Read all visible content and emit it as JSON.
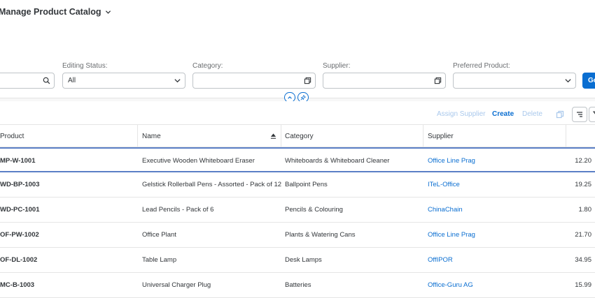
{
  "header": {
    "title": "Manage Product Catalog"
  },
  "filters": [
    {
      "key": "search",
      "label": "",
      "value": ""
    },
    {
      "key": "editing_status",
      "label": "Editing Status:",
      "value": "All"
    },
    {
      "key": "category",
      "label": "Category:",
      "value": ""
    },
    {
      "key": "supplier",
      "label": "Supplier:",
      "value": ""
    },
    {
      "key": "preferred_product",
      "label": "Preferred Product:",
      "value": ""
    }
  ],
  "go_label": "Go",
  "toolbar": {
    "assign_supplier": "Assign Supplier",
    "create": "Create",
    "delete": "Delete"
  },
  "table": {
    "columns": [
      "Product",
      "Name",
      "Category",
      "Supplier",
      ""
    ],
    "rows": [
      {
        "product": "MP-W-1001",
        "name": "Executive Wooden Whiteboard Eraser",
        "category": "Whiteboards & Whiteboard Cleaner",
        "supplier": "Office Line Prag",
        "price": "12.20"
      },
      {
        "product": "WD-BP-1003",
        "name": "Gelstick Rollerball Pens - Assorted - Pack of 12",
        "category": "Ballpoint Pens",
        "supplier": "ITeL-Office",
        "price": "19.25"
      },
      {
        "product": "WD-PC-1001",
        "name": "Lead Pencils - Pack of 6",
        "category": "Pencils & Colouring",
        "supplier": "ChinaChain",
        "price": "1.80"
      },
      {
        "product": "OF-PW-1002",
        "name": "Office Plant",
        "category": "Plants & Watering Cans",
        "supplier": "Office Line Prag",
        "price": "21.70"
      },
      {
        "product": "OF-DL-1002",
        "name": "Table Lamp",
        "category": "Desk Lamps",
        "supplier": "OffIPOR",
        "price": "34.95"
      },
      {
        "product": "MC-B-1003",
        "name": "Universal Charger Plug",
        "category": "Batteries",
        "supplier": "Office-Guru AG",
        "price": "15.99"
      }
    ]
  },
  "colors": {
    "accent": "#0a6ed1",
    "selected_row_border": "#5b7fc6",
    "disabled": "#a9c8ec"
  }
}
